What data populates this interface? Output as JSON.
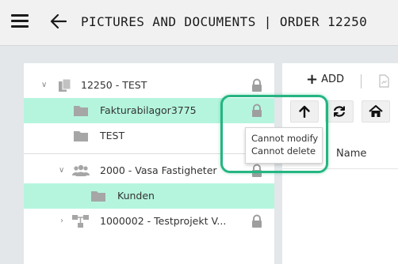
{
  "header": {
    "title": "PICTURES AND DOCUMENTS | ORDER 12250",
    "menu_icon": "hamburger-icon",
    "back_icon": "arrow-left-icon"
  },
  "tree": {
    "rows": [
      {
        "label": "12250 - TEST",
        "icon": "documents-icon",
        "expander": "chevron-down",
        "locked": true,
        "selected": false
      },
      {
        "label": "Fakturabilagor3775",
        "icon": "folder-icon",
        "locked": true,
        "selected": true
      },
      {
        "label": "TEST",
        "icon": "folder-icon",
        "locked": true,
        "selected": false
      },
      {
        "label": "2000 - Vasa Fastigheter",
        "icon": "users-icon",
        "expander": "chevron-down",
        "locked": true,
        "selected": false
      },
      {
        "label": "Kunden",
        "icon": "folder-icon",
        "locked": false,
        "selected": true
      },
      {
        "label": "1000002 - Testprojekt V...",
        "icon": "sitemap-icon",
        "expander": "chevron-right",
        "locked": true,
        "selected": false
      }
    ]
  },
  "tooltip": {
    "line1": "Cannot modify",
    "line2": "Cannot delete"
  },
  "toolbar": {
    "add_label": "ADD",
    "up_icon": "arrow-up-icon",
    "refresh_icon": "refresh-icon",
    "home_icon": "home-icon"
  },
  "file_list": {
    "name_header": "Name"
  },
  "colors": {
    "selected_row": "#b5f5de",
    "highlight_ring": "#25b582",
    "icon_gray": "#a6a6a6"
  }
}
